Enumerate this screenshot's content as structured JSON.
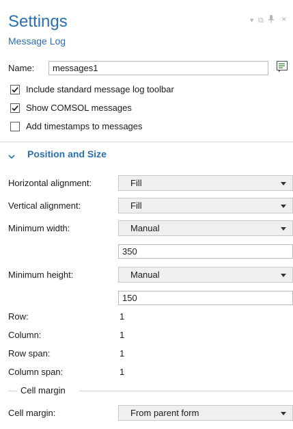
{
  "header": {
    "title": "Settings",
    "subtitle": "Message Log"
  },
  "window_controls": {
    "dropdown_glyph": "▾",
    "float_glyph": "⧉",
    "pin_glyph": "⊥",
    "close_glyph": "×"
  },
  "name_row": {
    "label": "Name:",
    "value": "messages1",
    "icon": "edit-list-icon"
  },
  "checkboxes": [
    {
      "label": "Include standard message log toolbar",
      "checked": true
    },
    {
      "label": "Show COMSOL messages",
      "checked": true
    },
    {
      "label": "Add timestamps to messages",
      "checked": false
    }
  ],
  "section": {
    "chevron": "⌄",
    "title": "Position and Size"
  },
  "layout": {
    "horizontal_alignment": {
      "label": "Horizontal alignment:",
      "value": "Fill"
    },
    "vertical_alignment": {
      "label": "Vertical alignment:",
      "value": "Fill"
    },
    "minimum_width": {
      "label": "Minimum width:",
      "mode": "Manual",
      "value": "350"
    },
    "minimum_height": {
      "label": "Minimum height:",
      "mode": "Manual",
      "value": "150"
    },
    "row": {
      "label": "Row:",
      "value": "1"
    },
    "column": {
      "label": "Column:",
      "value": "1"
    },
    "row_span": {
      "label": "Row span:",
      "value": "1"
    },
    "column_span": {
      "label": "Column span:",
      "value": "1"
    }
  },
  "cell_margin_group": {
    "group_label": "Cell margin",
    "label": "Cell margin:",
    "value": "From parent form"
  },
  "colors": {
    "accent": "#2a6fb0",
    "combo_bg": "#efefef"
  }
}
